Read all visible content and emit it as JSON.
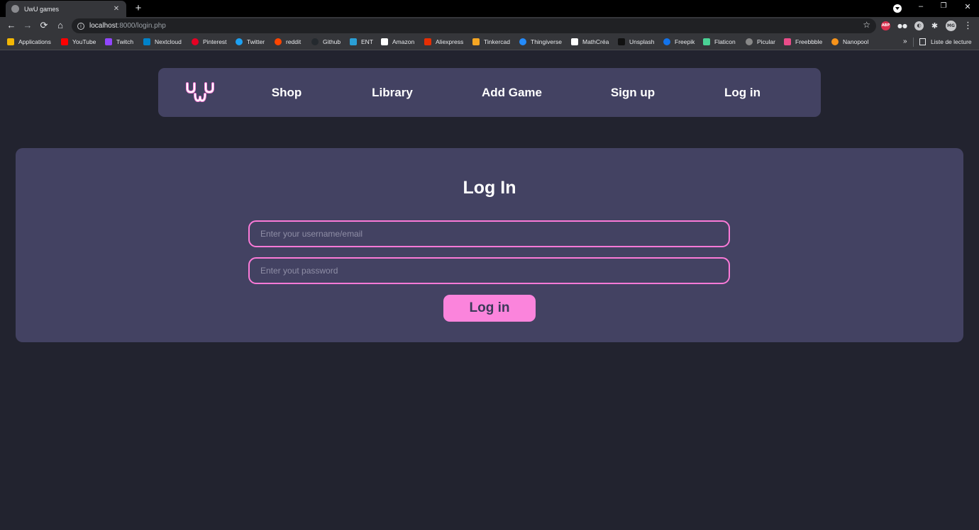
{
  "browser": {
    "tab": {
      "title": "UwU games"
    },
    "omnibox": {
      "host": "localhost",
      "path": ":8000/login.php"
    },
    "window_controls": {
      "minimize": "–",
      "maximize": "❐",
      "close": "✕"
    },
    "extensions": [
      {
        "icon": "adblock-icon",
        "label": "ABP"
      },
      {
        "icon": "glasses-extension-icon",
        "label": ""
      },
      {
        "icon": "chrome-extension-icon",
        "label": ""
      },
      {
        "icon": "puzzle-icon",
        "label": ""
      },
      {
        "icon": "profile-avatar-icon",
        "label": "MG"
      }
    ],
    "bookmarks": [
      {
        "label": "Applications",
        "color": "#f2b705"
      },
      {
        "label": "YouTube",
        "color": "#ff0000"
      },
      {
        "label": "Twitch",
        "color": "#9146ff"
      },
      {
        "label": "Nextcloud",
        "color": "#0082c9"
      },
      {
        "label": "Pinterest",
        "color": "#e60023"
      },
      {
        "label": "Twitter",
        "color": "#1da1f2"
      },
      {
        "label": "reddit",
        "color": "#ff4500"
      },
      {
        "label": "Github",
        "color": "#24292e"
      },
      {
        "label": "ENT",
        "color": "#2a9fd6"
      },
      {
        "label": "Amazon",
        "color": "#ffffff"
      },
      {
        "label": "Aliexpress",
        "color": "#e62e04"
      },
      {
        "label": "Tinkercad",
        "color": "#f5a623"
      },
      {
        "label": "Thingiverse",
        "color": "#248bfb"
      },
      {
        "label": "MathCréa",
        "color": "#ffffff"
      },
      {
        "label": "Unsplash",
        "color": "#111111"
      },
      {
        "label": "Freepik",
        "color": "#1273eb"
      },
      {
        "label": "Flaticon",
        "color": "#4ad295"
      },
      {
        "label": "Picular",
        "color": "#888888"
      },
      {
        "label": "Freebbble",
        "color": "#ea4c89"
      },
      {
        "label": "Nanopool",
        "color": "#f7931a"
      }
    ],
    "bookmarks_more": "»",
    "reading_list": "Liste de lecture"
  },
  "site": {
    "nav": {
      "links": [
        {
          "label": "Shop"
        },
        {
          "label": "Library"
        },
        {
          "label": "Add Game"
        },
        {
          "label": "Sign up"
        },
        {
          "label": "Log in"
        }
      ]
    },
    "login": {
      "title": "Log In",
      "username_placeholder": "Enter your username/email",
      "username_value": "",
      "password_placeholder": "Enter yout password",
      "password_value": "",
      "submit_label": "Log in"
    }
  },
  "colors": {
    "page_bg": "#22232f",
    "panel_bg": "#434262",
    "accent_pink": "#fb84dc",
    "field_border": "#fb7ad8"
  }
}
